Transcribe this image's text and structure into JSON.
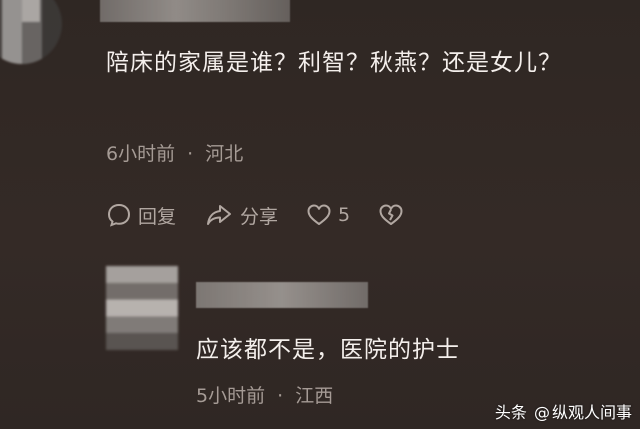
{
  "comment": {
    "text": "陪床的家属是谁？利智？秋燕？还是女儿？",
    "time": "6小时前",
    "location": "河北",
    "separator": "·",
    "actions": {
      "reply_label": "回复",
      "share_label": "分享",
      "like_count": "5"
    }
  },
  "reply": {
    "text": "应该都不是，医院的护士",
    "time": "5小时前",
    "location": "江西",
    "separator": "·"
  },
  "watermark": {
    "platform": "头条",
    "at": "@",
    "author": "纵观人间事"
  },
  "icons": {
    "reply": "comment-bubble-icon",
    "share": "share-arrow-icon",
    "like": "heart-icon",
    "dislike": "broken-heart-icon"
  },
  "colors": {
    "background": "#322926",
    "text": "#f4efec",
    "meta": "#a59b95"
  }
}
